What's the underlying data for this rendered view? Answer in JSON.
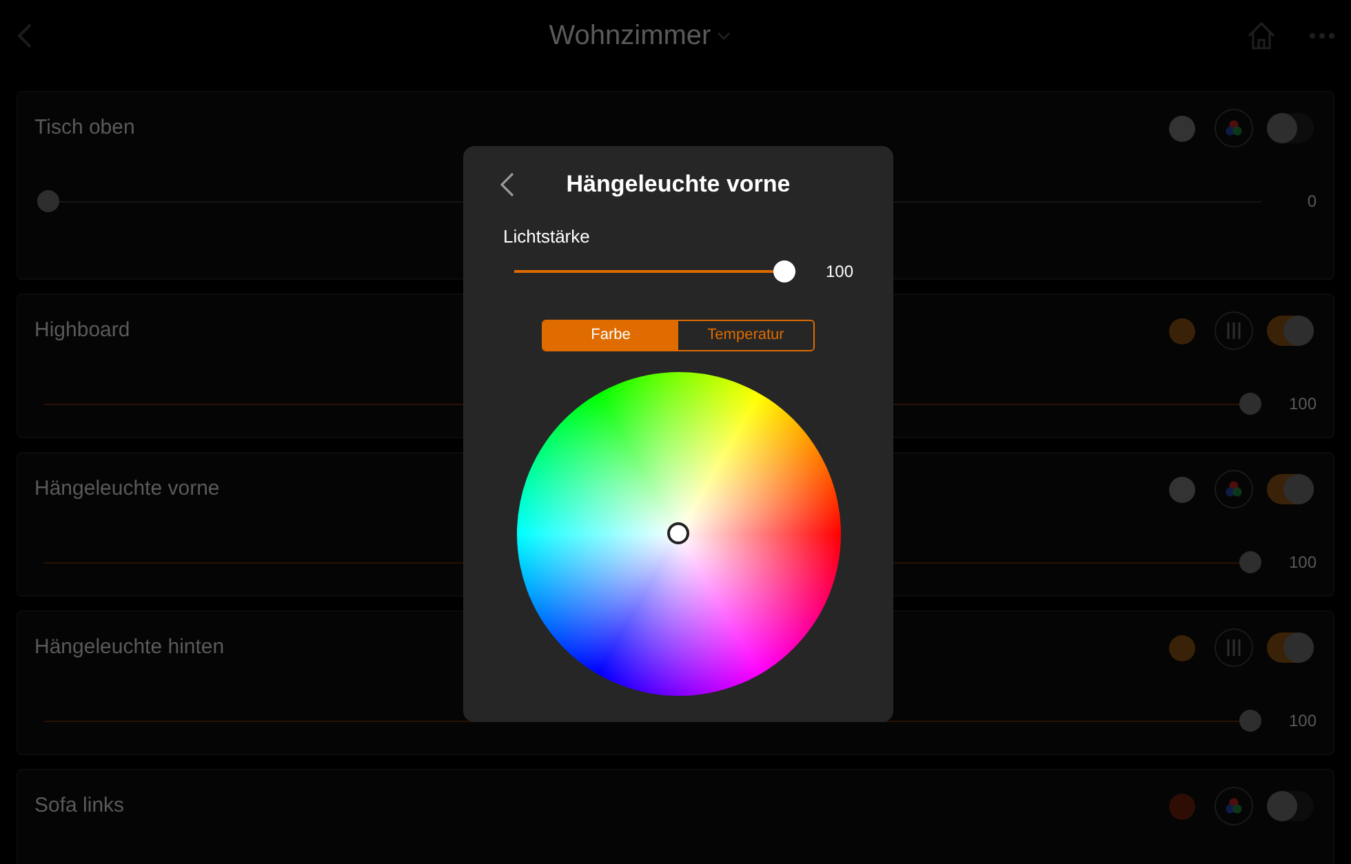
{
  "header": {
    "title": "Wohnzimmer"
  },
  "devices": [
    {
      "name": "Tisch oben",
      "color": "#333333",
      "kind": "color",
      "on": false,
      "level": 0,
      "reading": "0"
    },
    {
      "name": "Highboard",
      "color": "#3a2208",
      "kind": "sliders",
      "on": true,
      "level": 1,
      "reading": "100"
    },
    {
      "name": "Hängeleuchte vorne",
      "color": "#333333",
      "kind": "color",
      "on": true,
      "level": 1,
      "reading": "100"
    },
    {
      "name": "Hängeleuchte hinten",
      "color": "#3a2208",
      "kind": "sliders",
      "on": true,
      "level": 1,
      "reading": "100"
    },
    {
      "name": "Sofa links",
      "color": "#2e0d04",
      "kind": "color",
      "on": false
    }
  ],
  "dialog": {
    "title": "Hängeleuchte vorne",
    "brightness": {
      "label": "Lichtstärke",
      "level": 1,
      "reading": "100"
    },
    "tabs": [
      {
        "label": "Farbe",
        "selected": true
      },
      {
        "label": "Temperatur",
        "selected": false
      }
    ]
  }
}
